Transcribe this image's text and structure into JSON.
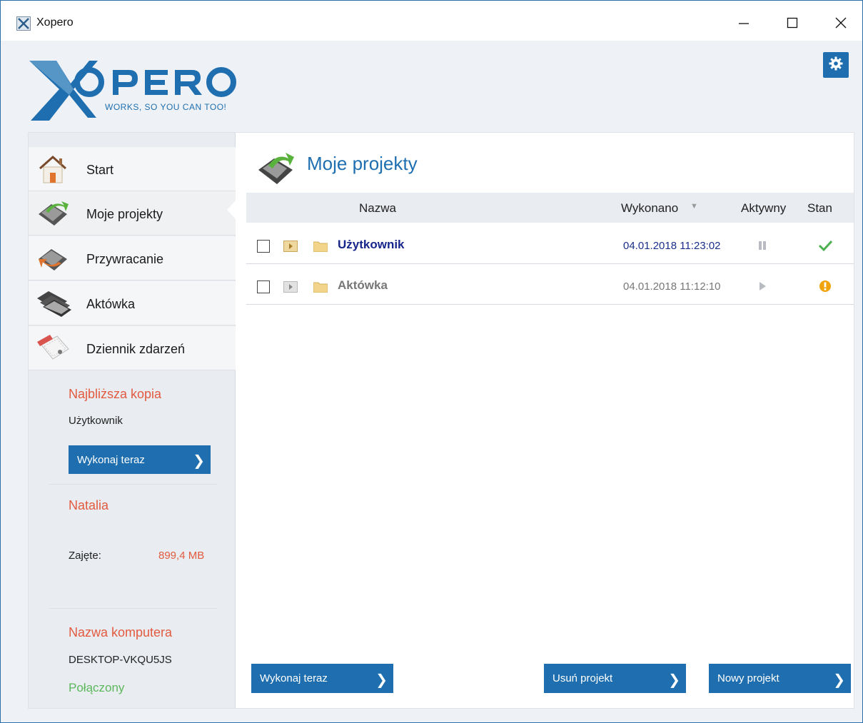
{
  "window": {
    "title": "Xopero",
    "minimize_glyph": "—",
    "maximize_glyph": "☐",
    "close_glyph": "✕"
  },
  "header": {
    "logo_text": "XOPERO",
    "logo_tagline": "WORKS, SO YOU CAN TOO!",
    "settings_icon": "gear-icon"
  },
  "sidebar": {
    "items": [
      {
        "label": "Start",
        "icon": "home-icon"
      },
      {
        "label": "Moje projekty",
        "icon": "projects-icon"
      },
      {
        "label": "Przywracanie",
        "icon": "restore-icon"
      },
      {
        "label": "Aktówka",
        "icon": "briefcase-icon"
      },
      {
        "label": "Dziennik zdarzeń",
        "icon": "event-log-icon"
      }
    ],
    "active_index": 1,
    "next_backup": {
      "title": "Najbliższa kopia",
      "project": "Użytkownik",
      "button_label": "Wykonaj teraz"
    },
    "account": {
      "title": "Natalia",
      "used_label": "Zajęte:",
      "used_value": "899,4 MB"
    },
    "computer": {
      "title": "Nazwa komputera",
      "name": "DESKTOP-VKQU5JS",
      "status": "Połączony"
    }
  },
  "main": {
    "title": "Moje projekty",
    "columns": {
      "name": "Nazwa",
      "done": "Wykonano",
      "active": "Aktywny",
      "state": "Stan"
    },
    "rows": [
      {
        "name": "Użytkownik",
        "date": "04.01.2018 11:23:02",
        "active": "paused",
        "state": "ok"
      },
      {
        "name": "Aktówka",
        "date": "04.01.2018 11:12:10",
        "active": "play",
        "state": "warning"
      }
    ],
    "buttons": {
      "run_now": "Wykonaj teraz",
      "delete_project": "Usuń projekt",
      "new_project": "Nowy projekt"
    }
  },
  "colors": {
    "accent": "#1f6fb0",
    "highlight": "#e25a3f",
    "success": "#5cb85c",
    "warning": "#f0a30a"
  }
}
